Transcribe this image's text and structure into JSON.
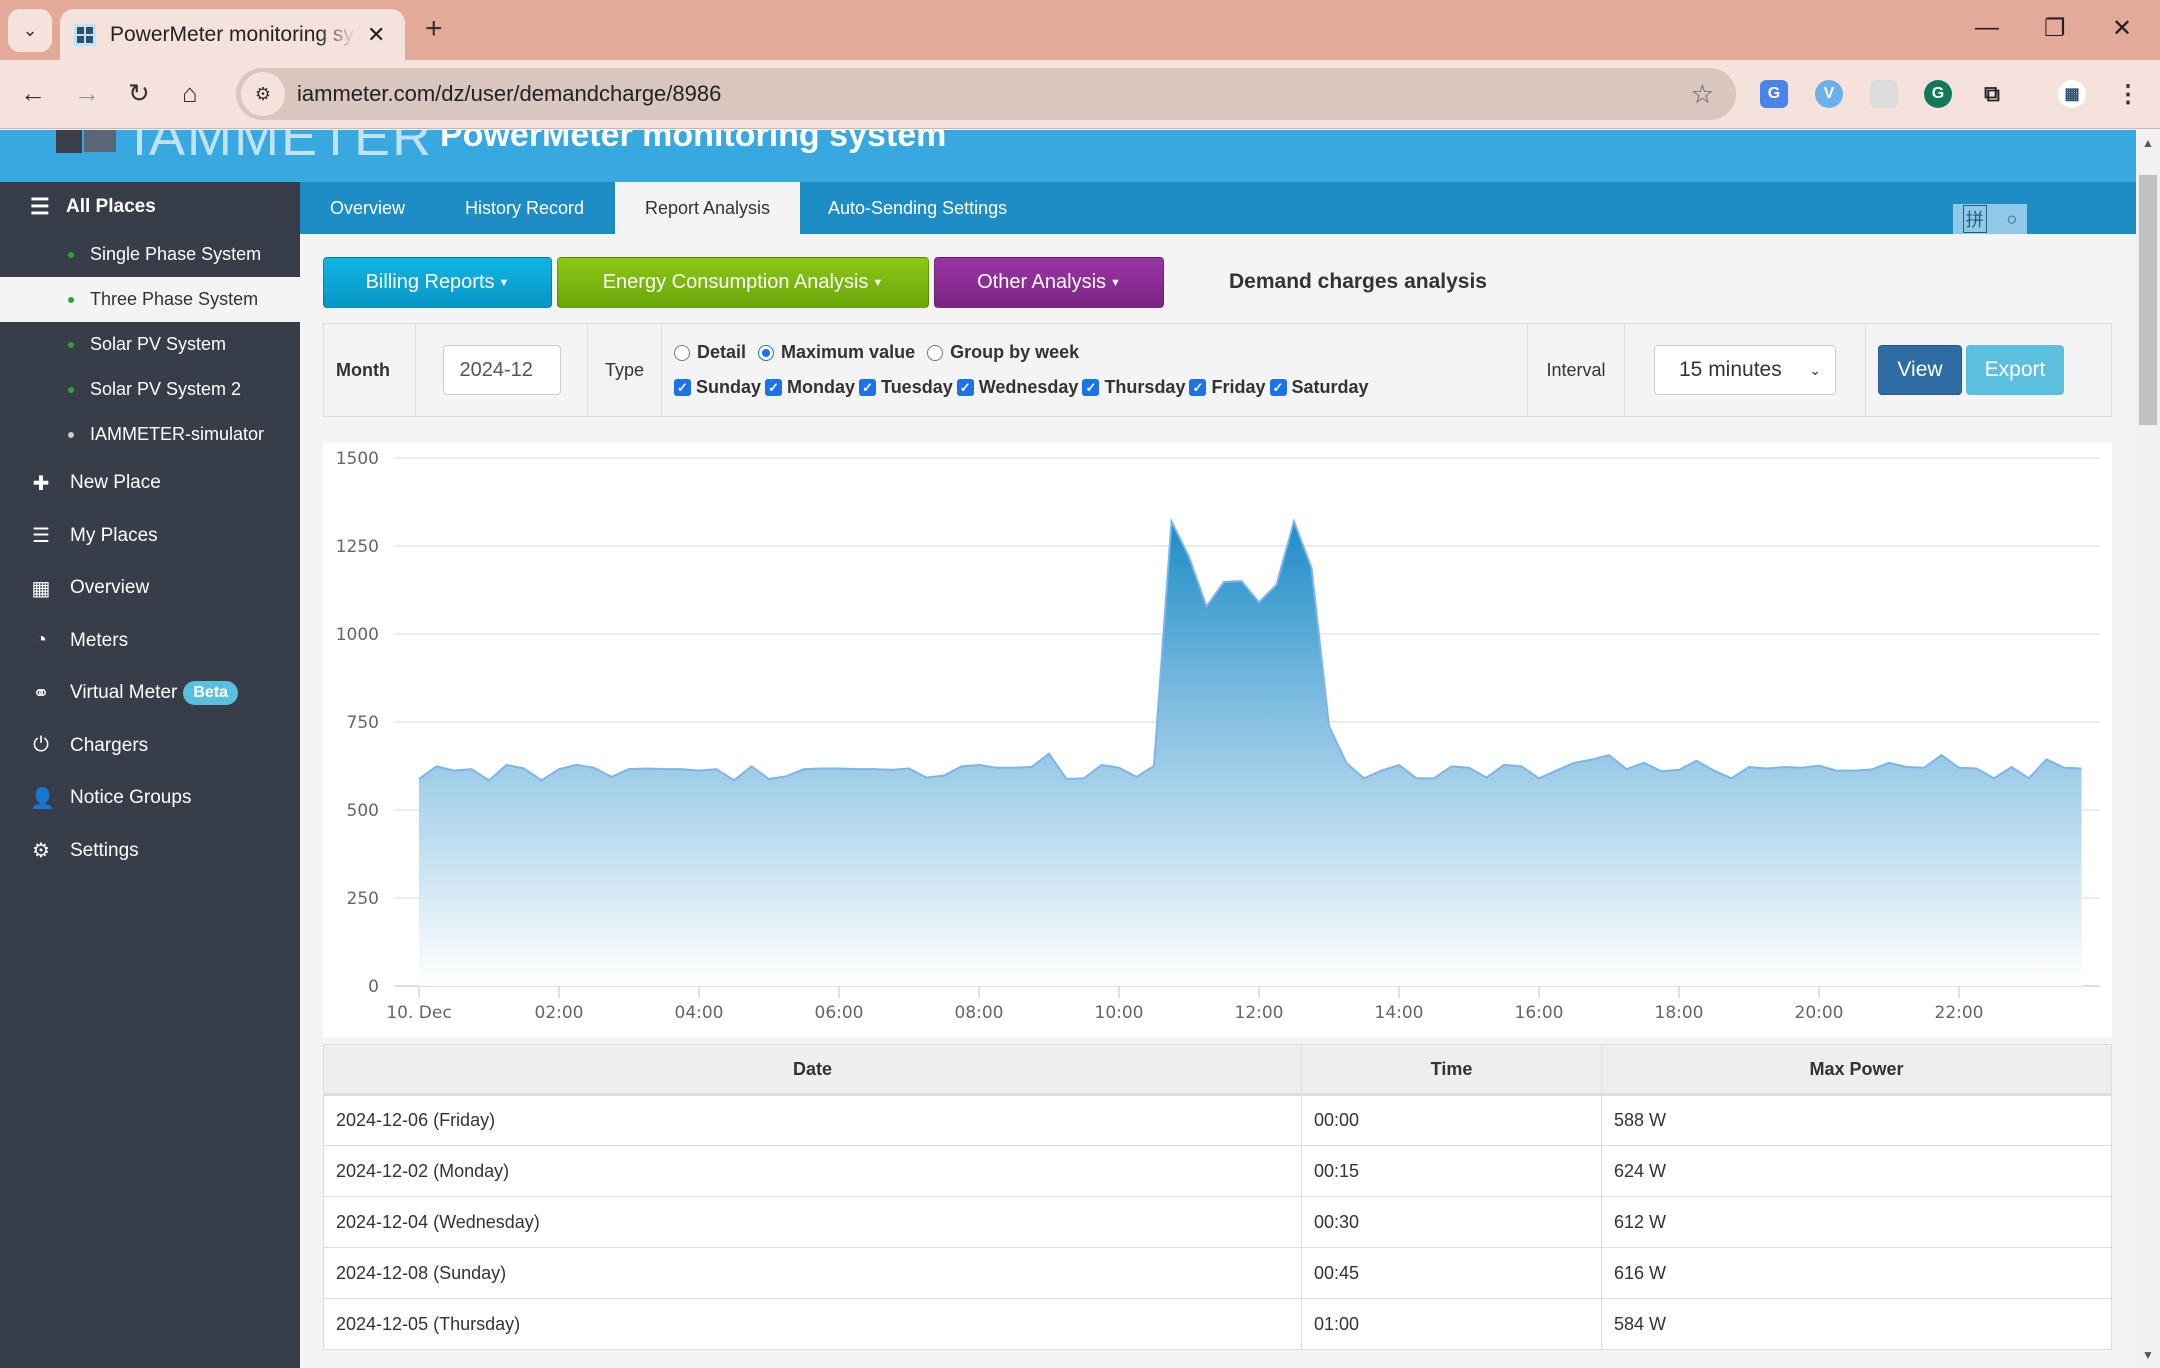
{
  "browser": {
    "tab_title": "PowerMeter monitoring system",
    "url": "iammeter.com/dz/user/demandcharge/8986",
    "new_tab_label": "+",
    "extensions": [
      "google-translate-icon",
      "vpn-icon",
      "screenshot-icon",
      "grammarly-icon",
      "extensions-icon",
      "profile-avatar-icon"
    ]
  },
  "header": {
    "logo_text": "IAMMETER",
    "title": "PowerMeter monitoring system"
  },
  "sidebar": {
    "all_places_label": "All Places",
    "places": [
      {
        "label": "Single Phase System",
        "status_color": "#2aa82a",
        "active": false
      },
      {
        "label": "Three Phase System",
        "status_color": "#2aa82a",
        "active": true
      },
      {
        "label": "Solar PV System",
        "status_color": "#2aa82a",
        "active": false
      },
      {
        "label": "Solar PV System 2",
        "status_color": "#2aa82a",
        "active": false
      },
      {
        "label": "IAMMETER-simulator",
        "status_color": "#cccccc",
        "active": false
      }
    ],
    "items": [
      {
        "label": "New Place",
        "icon": "plus-icon"
      },
      {
        "label": "My Places",
        "icon": "list-icon"
      },
      {
        "label": "Overview",
        "icon": "grid-icon"
      },
      {
        "label": "Meters",
        "icon": "dashboard-icon"
      },
      {
        "label": "Virtual Meter",
        "icon": "link-icon",
        "badge": "Beta"
      },
      {
        "label": "Chargers",
        "icon": "power-icon"
      },
      {
        "label": "Notice Groups",
        "icon": "user-icon"
      },
      {
        "label": "Settings",
        "icon": "gear-icon"
      }
    ]
  },
  "tabs": [
    {
      "label": "Overview",
      "active": false
    },
    {
      "label": "History Record",
      "active": false
    },
    {
      "label": "Report Analysis",
      "active": true
    },
    {
      "label": "Auto-Sending Settings",
      "active": false
    }
  ],
  "ime_toolbar": {
    "glyph": "拼"
  },
  "report_buttons": [
    {
      "label": "Billing Reports",
      "color": "#08a8d8"
    },
    {
      "label": "Energy Consumption Analysis",
      "color": "#7dba0e"
    },
    {
      "label": "Other Analysis",
      "color": "#8b2d94"
    }
  ],
  "page_title": "Demand charges analysis",
  "filter": {
    "month_label": "Month",
    "month_value": "2024-12",
    "type_label": "Type",
    "type_options": [
      {
        "label": "Detail",
        "selected": false
      },
      {
        "label": "Maximum value",
        "selected": true
      },
      {
        "label": "Group by week",
        "selected": false
      }
    ],
    "days": [
      {
        "label": "Sunday",
        "checked": true
      },
      {
        "label": "Monday",
        "checked": true
      },
      {
        "label": "Tuesday",
        "checked": true
      },
      {
        "label": "Wednesday",
        "checked": true
      },
      {
        "label": "Thursday",
        "checked": true
      },
      {
        "label": "Friday",
        "checked": true
      },
      {
        "label": "Saturday",
        "checked": true
      }
    ],
    "interval_label": "Interval",
    "interval_value": "15 minutes",
    "view_label": "View",
    "export_label": "Export"
  },
  "chart_data": {
    "type": "area",
    "title": "",
    "xlabel": "",
    "ylabel": "",
    "ylim": [
      0,
      1500
    ],
    "yticks": [
      0,
      250,
      500,
      750,
      1000,
      1250,
      1500
    ],
    "xtick_labels": [
      "10. Dec",
      "02:00",
      "04:00",
      "06:00",
      "08:00",
      "10:00",
      "12:00",
      "14:00",
      "16:00",
      "18:00",
      "20:00",
      "22:00"
    ],
    "x_step_minutes": 15,
    "x_start": "00:00",
    "grid": true,
    "legend": "none",
    "color": "#4a9fd4",
    "series": [
      {
        "name": "Max Power (W)",
        "values": [
          588,
          624,
          612,
          616,
          584,
          628,
          618,
          584,
          616,
          628,
          620,
          594,
          616,
          618,
          616,
          616,
          612,
          616,
          584,
          624,
          588,
          596,
          616,
          618,
          618,
          616,
          616,
          614,
          618,
          592,
          598,
          624,
          628,
          620,
          620,
          622,
          660,
          588,
          590,
          628,
          620,
          594,
          625,
          1320,
          1219,
          1078,
          1148,
          1150,
          1090,
          1140,
          1320,
          1188,
          738,
          633,
          590,
          612,
          628,
          590,
          590,
          624,
          620,
          592,
          628,
          624,
          590,
          612,
          634,
          643,
          656,
          616,
          634,
          610,
          614,
          640,
          612,
          590,
          622,
          618,
          622,
          620,
          626,
          612,
          612,
          615,
          634,
          622,
          620,
          656,
          620,
          618,
          590,
          622,
          590,
          644,
          620,
          618
        ]
      }
    ]
  },
  "table": {
    "columns": [
      "Date",
      "Time",
      "Max Power"
    ],
    "rows": [
      [
        "2024-12-06 (Friday)",
        "00:00",
        "588 W"
      ],
      [
        "2024-12-02 (Monday)",
        "00:15",
        "624 W"
      ],
      [
        "2024-12-04 (Wednesday)",
        "00:30",
        "612 W"
      ],
      [
        "2024-12-08 (Sunday)",
        "00:45",
        "616 W"
      ],
      [
        "2024-12-05 (Thursday)",
        "01:00",
        "584 W"
      ]
    ]
  }
}
